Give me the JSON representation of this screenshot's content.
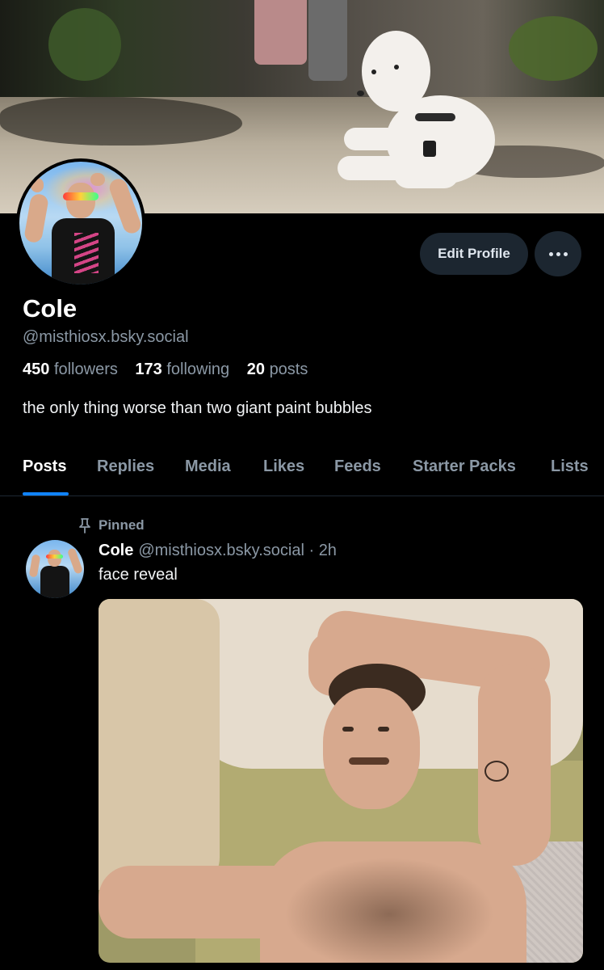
{
  "profile": {
    "display_name": "Cole",
    "handle": "@misthiosx.bsky.social",
    "stats": {
      "followers_count": "450",
      "followers_label": "followers",
      "following_count": "173",
      "following_label": "following",
      "posts_count": "20",
      "posts_label": "posts"
    },
    "bio": "the only thing worse than two giant paint bubbles",
    "edit_label": "Edit Profile"
  },
  "tabs": [
    {
      "label": "Posts",
      "active": true
    },
    {
      "label": "Replies"
    },
    {
      "label": "Media"
    },
    {
      "label": "Likes"
    },
    {
      "label": "Feeds"
    },
    {
      "label": "Starter Packs"
    },
    {
      "label": "Lists"
    }
  ],
  "post": {
    "pinned_label": "Pinned",
    "author": "Cole",
    "handle": "@misthiosx.bsky.social",
    "separator": "·",
    "time": "2h",
    "text": "face reveal"
  },
  "colors": {
    "background": "#000000",
    "accent": "#1083fe",
    "muted_text": "#8b98a5",
    "button_bg": "#1c2630"
  },
  "icons": {
    "more": "ellipsis-icon",
    "pinned": "pin-icon"
  }
}
